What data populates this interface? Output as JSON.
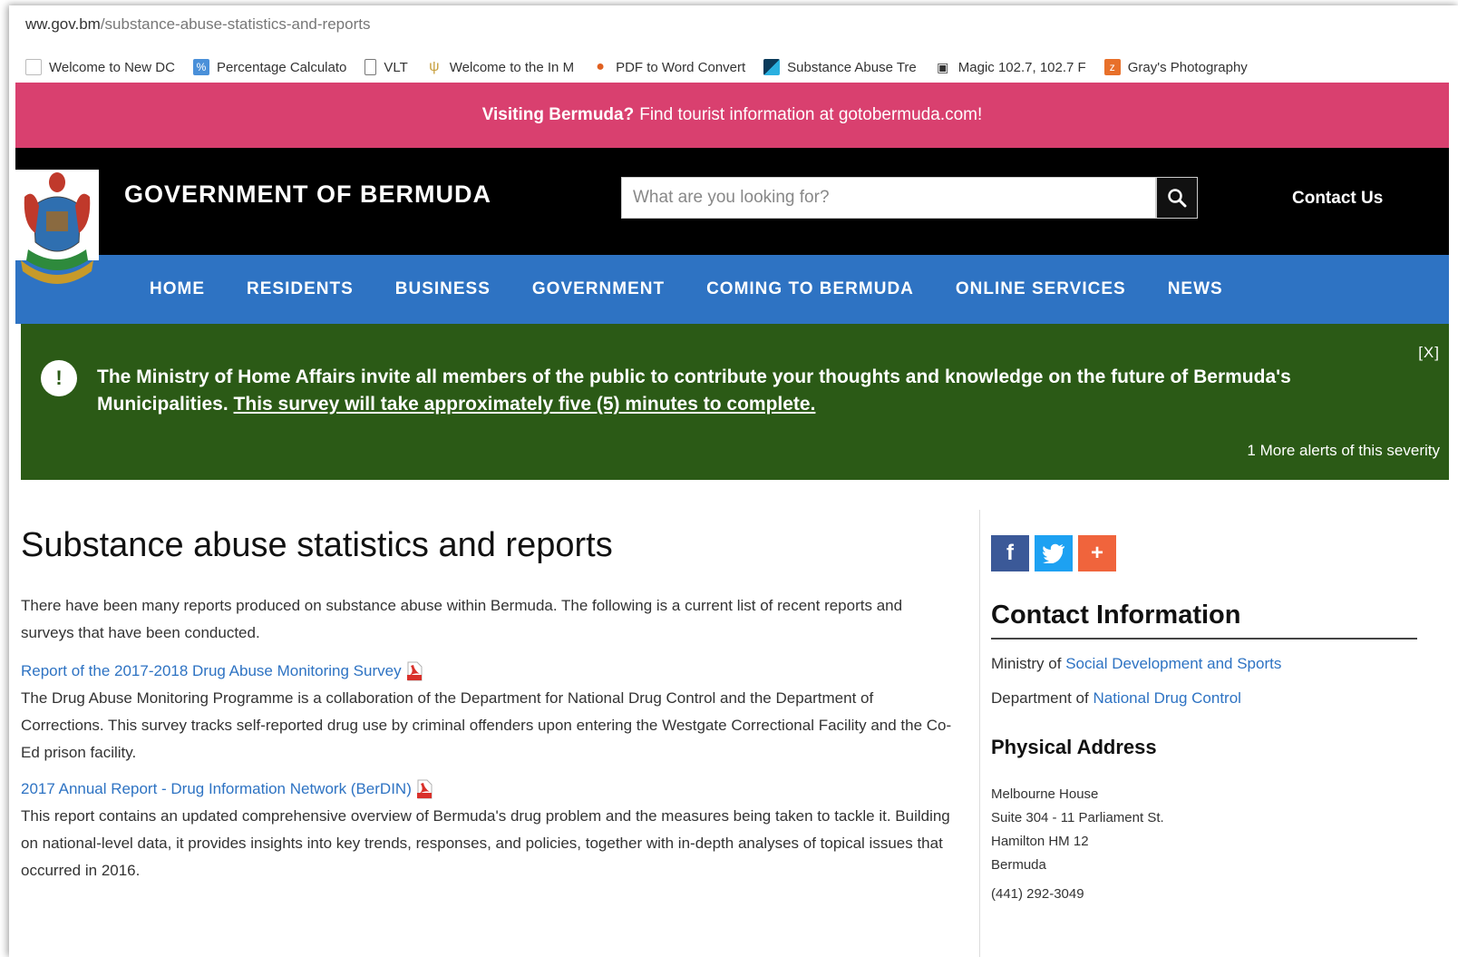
{
  "browser": {
    "address_host": "ww.gov.bm",
    "address_path": "/substance-abuse-statistics-and-reports",
    "bookmarks": [
      {
        "label": "Welcome to New DC",
        "icon": "page-icon",
        "color": ""
      },
      {
        "label": "Percentage Calculato",
        "icon": "calculator-icon",
        "color": "#4a90d9"
      },
      {
        "label": "VLT",
        "icon": "document-icon",
        "color": ""
      },
      {
        "label": "Welcome to the In M",
        "icon": "wheat-icon",
        "color": "#c8a040"
      },
      {
        "label": "PDF to Word Convert",
        "icon": "pdf-converter-icon",
        "color": "#e06020"
      },
      {
        "label": "Substance Abuse Tre",
        "icon": "site-icon",
        "color": "#1a6a9a"
      },
      {
        "label": "Magic 102.7, 102.7 F",
        "icon": "radio-icon",
        "color": "#333333"
      },
      {
        "label": "Gray's Photography",
        "icon": "photo-icon",
        "color": "#e8702a"
      }
    ]
  },
  "banner": {
    "bold": "Visiting Bermuda?",
    "text": "Find tourist information at gotobermuda.com!"
  },
  "header": {
    "title": "GOVERNMENT OF BERMUDA",
    "search_placeholder": "What are you looking for?",
    "contact": "Contact Us"
  },
  "nav": [
    "HOME",
    "RESIDENTS",
    "BUSINESS",
    "GOVERNMENT",
    "COMING TO BERMUDA",
    "ONLINE SERVICES",
    "NEWS"
  ],
  "alert": {
    "text": "The Ministry of Home Affairs invite all members of the public to contribute your thoughts and knowledge on the future of Bermuda's Municipalities.",
    "link": "This survey will take approximately five (5) minutes to complete.",
    "close": "[X]",
    "more": "1 More alerts of this severity"
  },
  "main": {
    "title": "Substance abuse statistics and reports",
    "intro": "There have been many reports produced on substance abuse within Bermuda. The following is a current list of recent reports and surveys that have been conducted.",
    "reports": [
      {
        "title": "Report of the 2017-2018 Drug Abuse Monitoring Survey",
        "description": "The Drug Abuse Monitoring Programme is a collaboration of the Department for National Drug Control and the Department of Corrections. This survey tracks self-reported drug use by criminal offenders upon entering the Westgate Correctional Facility and the Co-Ed prison facility."
      },
      {
        "title": "2017 Annual Report - Drug Information Network (BerDIN)",
        "description": "This report contains an updated comprehensive overview of Bermuda's drug problem and the measures being taken to tackle it. Building on national-level data, it provides insights into key trends, responses, and policies, together with in-depth analyses of topical issues that occurred in 2016."
      }
    ]
  },
  "sidebar": {
    "heading": "Contact Information",
    "ministry_prefix": "Ministry of",
    "ministry_link": "Social Development and Sports",
    "department_prefix": "Department of",
    "department_link": "National Drug Control",
    "address_heading": "Physical Address",
    "address_lines": [
      "Melbourne House",
      "Suite 304 - 11 Parliament St.",
      "Hamilton HM 12",
      "Bermuda"
    ],
    "phone": "(441) 292-3049"
  },
  "colors": {
    "banner_pink": "#d9406f",
    "nav_blue": "#2e73c3",
    "alert_green": "#2b5a16",
    "facebook": "#3b5998",
    "twitter": "#1da1f2",
    "share": "#f0643c"
  }
}
